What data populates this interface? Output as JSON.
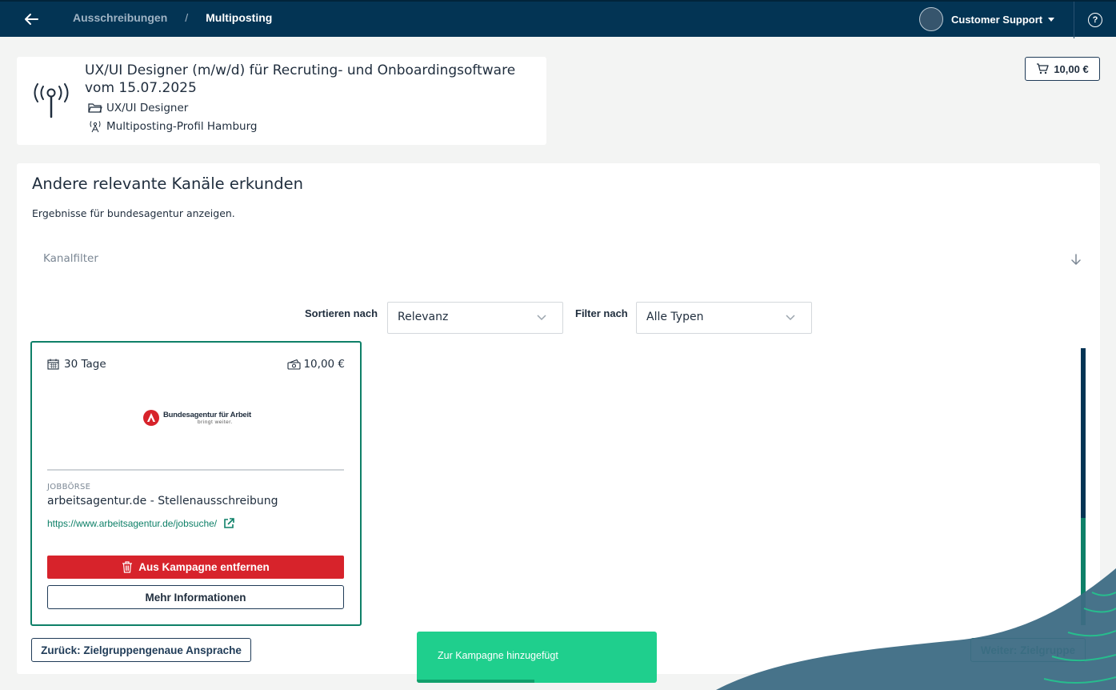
{
  "header": {
    "breadcrumb_parent": "Ausschreibungen",
    "breadcrumb_separator": "/",
    "breadcrumb_current": "Multiposting",
    "user_name": "Customer Support",
    "help_icon": "?"
  },
  "job": {
    "title": "UX/UI Designer (m/w/d) für Recruting- und Onboardingsoftware vom 15.07.2025",
    "category": "UX/UI Designer",
    "profile": "Multiposting-Profil Hamburg"
  },
  "cart": {
    "total": "10,00 €"
  },
  "explore": {
    "title": "Andere relevante Kanäle erkunden",
    "subtitle": "Ergebnisse für bundesagentur anzeigen.",
    "channel_filter_label": "Kanalfilter",
    "sort_label": "Sortieren nach",
    "sort_value": "Relevanz",
    "filter_label": "Filter nach",
    "filter_value": "Alle Typen"
  },
  "channels": [
    {
      "duration": "30 Tage",
      "price": "10,00 €",
      "logo_name": "Bundesagentur für Arbeit",
      "logo_slogan": "bringt weiter.",
      "type": "JOBBÖRSE",
      "name": "arbeitsagentur.de - Stellenausschreibung",
      "url": "https://www.arbeitsagentur.de/jobsuche/",
      "remove_label": "Aus Kampagne entfernen",
      "more_label": "Mehr Informationen"
    }
  ],
  "footer": {
    "back_label": "Zurück: Zielgruppengenaue Ansprache",
    "next_label": "Weiter: Zielgruppe"
  },
  "toast": {
    "message": "Zur Kampagne hinzugefügt",
    "progress": 0.49
  },
  "colors": {
    "header_bg": "#033454",
    "accent_green": "#0e8068",
    "danger_red": "#d7232b",
    "toast_green": "#1fcf8d"
  },
  "icons": {
    "back": "arrow-left-icon",
    "cart": "cart-icon",
    "broadcast": "broadcast-icon",
    "folder": "folder-icon",
    "antenna": "antenna-icon",
    "calendar": "calendar-icon",
    "money": "money-icon",
    "external_link": "external-link-icon",
    "trash": "trash-icon",
    "chevron": "chevron-down-icon",
    "arrow_down": "arrow-down-icon",
    "help": "help-icon"
  }
}
